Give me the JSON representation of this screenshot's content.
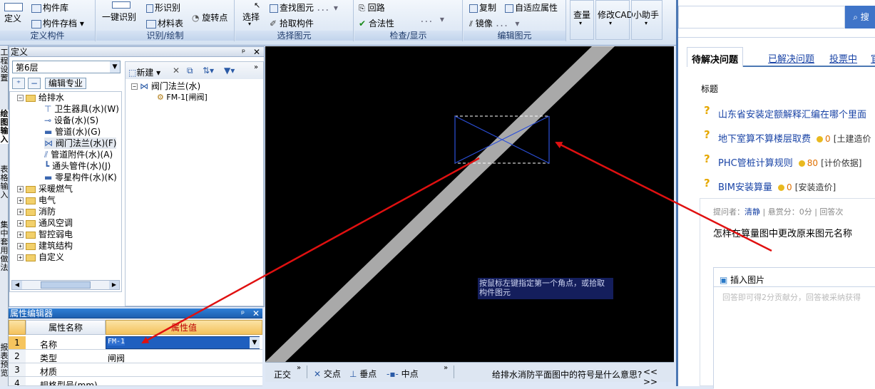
{
  "ribbon": {
    "groups": [
      {
        "label": "定义构件",
        "items": [
          "定义",
          "构件库",
          "构件存档"
        ]
      },
      {
        "label": "识别/绘制",
        "items": [
          "一键识别",
          "形识别",
          "材料表",
          "旋转点"
        ]
      },
      {
        "label": "选择图元",
        "items": [
          "选择",
          "查找图元",
          "拾取构件"
        ]
      },
      {
        "label": "检查/显示",
        "items": [
          "回路",
          "合法性"
        ]
      },
      {
        "label": "编辑图元",
        "items": [
          "复制",
          "自适应属性",
          "镜像"
        ]
      },
      {
        "label": "",
        "items": [
          "查量",
          "修改CAD",
          "小助手"
        ]
      }
    ]
  },
  "side_tabs": [
    "工程设置",
    "绘图输入",
    "表格输入",
    "集中套用做法",
    "报表预览"
  ],
  "definition_panel": {
    "title": "定义",
    "floor": "第6层",
    "edit_major": "编辑专业",
    "tree": [
      {
        "label": "给排水",
        "expanded": true,
        "children": [
          "卫生器具(水)(W)",
          "设备(水)(S)",
          "管道(水)(G)",
          "阀门法兰(水)(F)",
          "管道附件(水)(A)",
          "通头管件(水)(J)",
          "零星构件(水)(K)"
        ]
      },
      {
        "label": "采暖燃气"
      },
      {
        "label": "电气"
      },
      {
        "label": "消防"
      },
      {
        "label": "通风空调"
      },
      {
        "label": "智控弱电"
      },
      {
        "label": "建筑结构"
      },
      {
        "label": "自定义"
      }
    ]
  },
  "component_panel": {
    "new_button": "新建",
    "tree_root": "阀门法兰(水)",
    "tree_child": "FM-1[闸阀]"
  },
  "property_editor": {
    "title": "属性编辑器",
    "col_name": "属性名称",
    "col_value": "属性值",
    "rows": [
      {
        "idx": "1",
        "name": "名称",
        "value": "FM-1"
      },
      {
        "idx": "2",
        "name": "类型",
        "value": "闸阀"
      },
      {
        "idx": "3",
        "name": "材质",
        "value": ""
      },
      {
        "idx": "4",
        "name": "规格型号(mm)",
        "value": ""
      }
    ]
  },
  "canvas": {
    "tooltip": "按鼠标左键指定第一个角点，或拾取构件图元"
  },
  "statusbar": {
    "ortho": "正交",
    "snap_items": [
      "交点",
      "垂点",
      "中点"
    ],
    "message": "给排水消防平面图中的符号是什么意思?",
    "nav": "<< >>"
  },
  "qa_panel": {
    "tabs": [
      "待解决问题",
      "已解决问题",
      "投票中",
      "官"
    ],
    "header": "标题",
    "questions": [
      {
        "title": "山东省安装定额解释汇编在哪个里面",
        "coins": "",
        "tag": ""
      },
      {
        "title": "地下室算不算楼层取费",
        "coins": "0",
        "tag": "[土建造价"
      },
      {
        "title": "PHC管桩计算规则",
        "coins": "80",
        "tag": "[计价依据]"
      },
      {
        "title": "BIM安装算量",
        "coins": "0",
        "tag": "[安装造价]"
      }
    ],
    "meta": {
      "asker_label": "提问者：",
      "asker": "清静",
      "reward": "悬赏分：0分",
      "answers": "回答次"
    },
    "question_body": "怎样在算量图中更改原来图元名称",
    "insert_image": "插入图片",
    "answer_placeholder": "回答即可得2分贡献分，回答被采纳获得"
  },
  "colors": {
    "arrow": "#e01010",
    "canvas_bg": "#000000",
    "pipe": "#a9a9a9",
    "valve": "#2b4fd8"
  }
}
